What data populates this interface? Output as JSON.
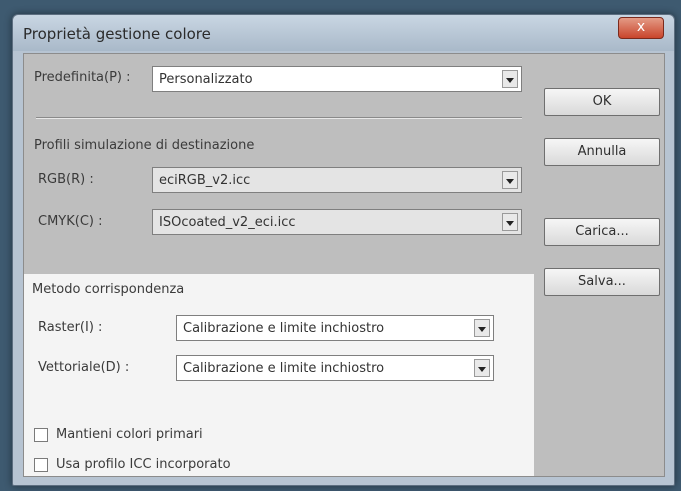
{
  "window": {
    "title": "Proprietà gestione colore",
    "close_label": "x"
  },
  "preset": {
    "label": "Predefinita(P) :",
    "value": "Personalizzato"
  },
  "simulation": {
    "heading": "Profili simulazione di destinazione",
    "rgb": {
      "label": "RGB(R) :",
      "value": "eciRGB_v2.icc"
    },
    "cmyk": {
      "label": "CMYK(C) :",
      "value": "ISOcoated_v2_eci.icc"
    }
  },
  "matching": {
    "heading": "Metodo corrispondenza",
    "raster": {
      "label": "Raster(I) :",
      "value": "Calibrazione e limite inchiostro"
    },
    "vector": {
      "label": "Vettoriale(D) :",
      "value": "Calibrazione e limite inchiostro"
    }
  },
  "options": {
    "primary": {
      "label": "Mantieni colori primari",
      "checked": false
    },
    "icc": {
      "label": "Usa profilo ICC incorporato",
      "checked": false
    }
  },
  "buttons": {
    "ok": "OK",
    "cancel": "Annulla",
    "load": "Carica...",
    "save": "Salva..."
  }
}
